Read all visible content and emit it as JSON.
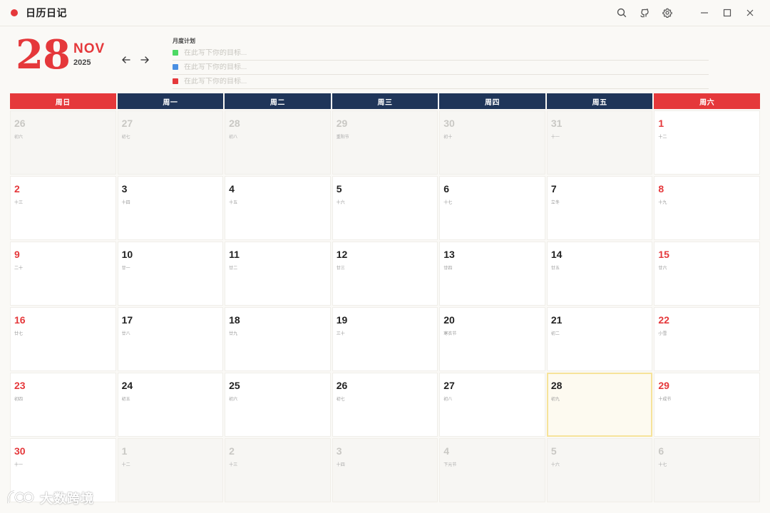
{
  "app": {
    "title": "日历日记"
  },
  "titlebar_icons": [
    "search-icon",
    "github-icon",
    "gear-icon",
    "minimize-icon",
    "maximize-icon",
    "close-icon"
  ],
  "header": {
    "day": "28",
    "month": "NOV",
    "year": "2025",
    "plan_title": "月度计划",
    "goals": [
      {
        "placeholder": "在此写下你的目标...",
        "value": "",
        "color": "#4cd964"
      },
      {
        "placeholder": "在此写下你的目标...",
        "value": "",
        "color": "#4a90e2"
      },
      {
        "placeholder": "在此写下你的目标...",
        "value": "",
        "color": "#e5383b"
      }
    ]
  },
  "colors": {
    "accent_red": "#e5383b",
    "header_navy": "#1f3559",
    "today_border": "#f6e39a"
  },
  "weekdays": [
    "周日",
    "周一",
    "周二",
    "周三",
    "周四",
    "周五",
    "周六"
  ],
  "weeks": [
    [
      {
        "d": "26",
        "l": "初六",
        "m": "prev"
      },
      {
        "d": "27",
        "l": "初七",
        "m": "prev"
      },
      {
        "d": "28",
        "l": "初八",
        "m": "prev"
      },
      {
        "d": "29",
        "l": "重阳节",
        "m": "prev"
      },
      {
        "d": "30",
        "l": "初十",
        "m": "prev"
      },
      {
        "d": "31",
        "l": "十一",
        "m": "prev"
      },
      {
        "d": "1",
        "l": "十二",
        "m": "cur"
      }
    ],
    [
      {
        "d": "2",
        "l": "十三",
        "m": "cur"
      },
      {
        "d": "3",
        "l": "十四",
        "m": "cur"
      },
      {
        "d": "4",
        "l": "十五",
        "m": "cur"
      },
      {
        "d": "5",
        "l": "十六",
        "m": "cur"
      },
      {
        "d": "6",
        "l": "十七",
        "m": "cur"
      },
      {
        "d": "7",
        "l": "立冬",
        "m": "cur"
      },
      {
        "d": "8",
        "l": "十九",
        "m": "cur"
      }
    ],
    [
      {
        "d": "9",
        "l": "二十",
        "m": "cur"
      },
      {
        "d": "10",
        "l": "廿一",
        "m": "cur"
      },
      {
        "d": "11",
        "l": "廿二",
        "m": "cur"
      },
      {
        "d": "12",
        "l": "廿三",
        "m": "cur"
      },
      {
        "d": "13",
        "l": "廿四",
        "m": "cur"
      },
      {
        "d": "14",
        "l": "廿五",
        "m": "cur"
      },
      {
        "d": "15",
        "l": "廿六",
        "m": "cur"
      }
    ],
    [
      {
        "d": "16",
        "l": "廿七",
        "m": "cur"
      },
      {
        "d": "17",
        "l": "廿八",
        "m": "cur"
      },
      {
        "d": "18",
        "l": "廿九",
        "m": "cur"
      },
      {
        "d": "19",
        "l": "三十",
        "m": "cur"
      },
      {
        "d": "20",
        "l": "寒衣节",
        "m": "cur"
      },
      {
        "d": "21",
        "l": "初二",
        "m": "cur"
      },
      {
        "d": "22",
        "l": "小雪",
        "m": "cur"
      }
    ],
    [
      {
        "d": "23",
        "l": "初四",
        "m": "cur"
      },
      {
        "d": "24",
        "l": "初五",
        "m": "cur"
      },
      {
        "d": "25",
        "l": "初六",
        "m": "cur"
      },
      {
        "d": "26",
        "l": "初七",
        "m": "cur"
      },
      {
        "d": "27",
        "l": "初八",
        "m": "cur"
      },
      {
        "d": "28",
        "l": "初九",
        "m": "cur",
        "today": true
      },
      {
        "d": "29",
        "l": "十成节",
        "m": "cur"
      }
    ],
    [
      {
        "d": "30",
        "l": "十一",
        "m": "cur"
      },
      {
        "d": "1",
        "l": "十二",
        "m": "next"
      },
      {
        "d": "2",
        "l": "十三",
        "m": "next"
      },
      {
        "d": "3",
        "l": "十四",
        "m": "next"
      },
      {
        "d": "4",
        "l": "下元节",
        "m": "next"
      },
      {
        "d": "5",
        "l": "十六",
        "m": "next"
      },
      {
        "d": "6",
        "l": "十七",
        "m": "next"
      }
    ]
  ],
  "watermark": {
    "text": "大数跨境"
  }
}
